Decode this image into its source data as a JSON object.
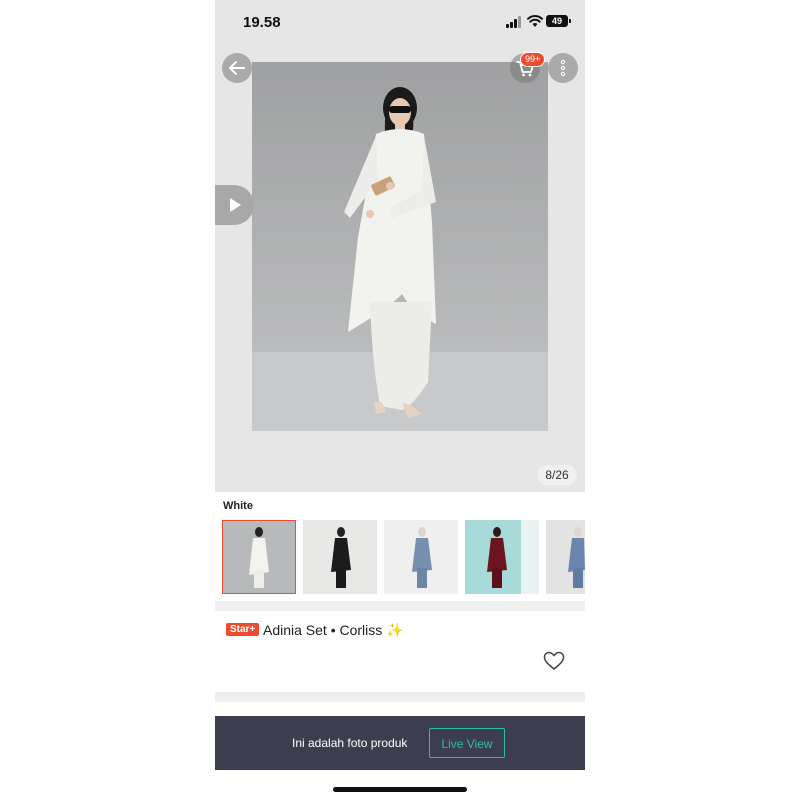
{
  "status_bar": {
    "time": "19.58",
    "battery": "49"
  },
  "gallery": {
    "cart_badge": "99+",
    "page_counter": "8/26",
    "icons": [
      "back-arrow-icon",
      "cart-icon",
      "more-vertical-icon",
      "play-icon"
    ]
  },
  "variation": {
    "label": "White",
    "thumbnails": [
      {
        "name": "White",
        "selected": true
      },
      {
        "name": "Black",
        "selected": false
      },
      {
        "name": "Blue",
        "selected": false
      },
      {
        "name": "Maroon",
        "selected": false
      },
      {
        "name": "Denim Blue",
        "selected": false
      }
    ]
  },
  "product": {
    "badge": "Star+",
    "title": "Adinia Set • Corliss ✨"
  },
  "banner": {
    "text": "Ini adalah foto produk",
    "button": "Live View"
  },
  "colors": {
    "accent": "#ee4d2d",
    "teal": "#2bbfa8",
    "banner_bg": "#3c3e4e"
  }
}
